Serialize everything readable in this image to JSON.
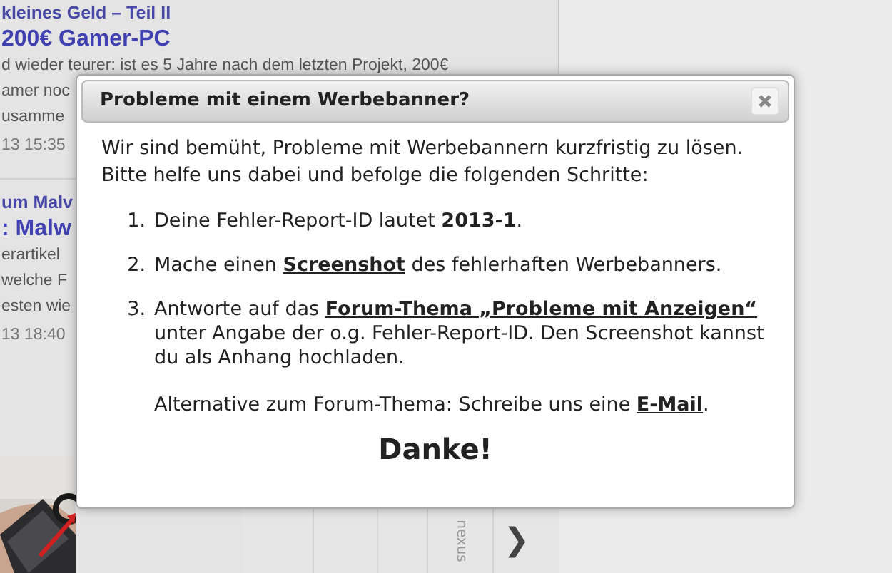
{
  "background": {
    "articles": [
      {
        "kicker": "kleines Geld – Teil II",
        "headline": "200€ Gamer-PC",
        "lines": [
          "d wieder teurer: ist es 5 Jahre nach dem letzten Projekt, 200€",
          "amer noc",
          "usamme"
        ],
        "time": "13 15:35"
      },
      {
        "kicker": "um Malv",
        "headline": ": Malw",
        "lines": [
          "erartikel",
          "welche F",
          "esten wie"
        ],
        "time": "13 18:40"
      }
    ],
    "carousel": {
      "label": "nexus",
      "next": "❯"
    }
  },
  "dialog": {
    "title": "Probleme mit einem Werbebanner?",
    "intro": "Wir sind bemüht, Probleme mit Werbebannern kurzfristig zu lösen. Bitte helfe uns dabei und befolge die folgenden Schritte:",
    "steps": [
      {
        "number": "1.",
        "paragraphs": [
          [
            {
              "kind": "plain",
              "text": "Deine Fehler-Report-ID lautet "
            },
            {
              "kind": "bold",
              "text": "2013-1"
            },
            {
              "kind": "plain",
              "text": "."
            }
          ]
        ]
      },
      {
        "number": "2.",
        "paragraphs": [
          [
            {
              "kind": "plain",
              "text": "Mache einen "
            },
            {
              "kind": "link",
              "text": "Screenshot"
            },
            {
              "kind": "plain",
              "text": " des fehlerhaften Werbebanners."
            }
          ]
        ]
      },
      {
        "number": "3.",
        "paragraphs": [
          [
            {
              "kind": "plain",
              "text": "Antworte auf das "
            },
            {
              "kind": "link",
              "text": "Forum-Thema „Probleme mit Anzeigen“"
            },
            {
              "kind": "plain",
              "text": " unter Angabe der o.g. Fehler-Report-ID. Den Screenshot kannst du als Anhang hochladen."
            }
          ],
          [
            {
              "kind": "plain",
              "text": "Alternative zum Forum-Thema: Schreibe uns eine "
            },
            {
              "kind": "link",
              "text": "E-Mail"
            },
            {
              "kind": "plain",
              "text": "."
            }
          ]
        ]
      }
    ],
    "thanks": "Danke!"
  }
}
